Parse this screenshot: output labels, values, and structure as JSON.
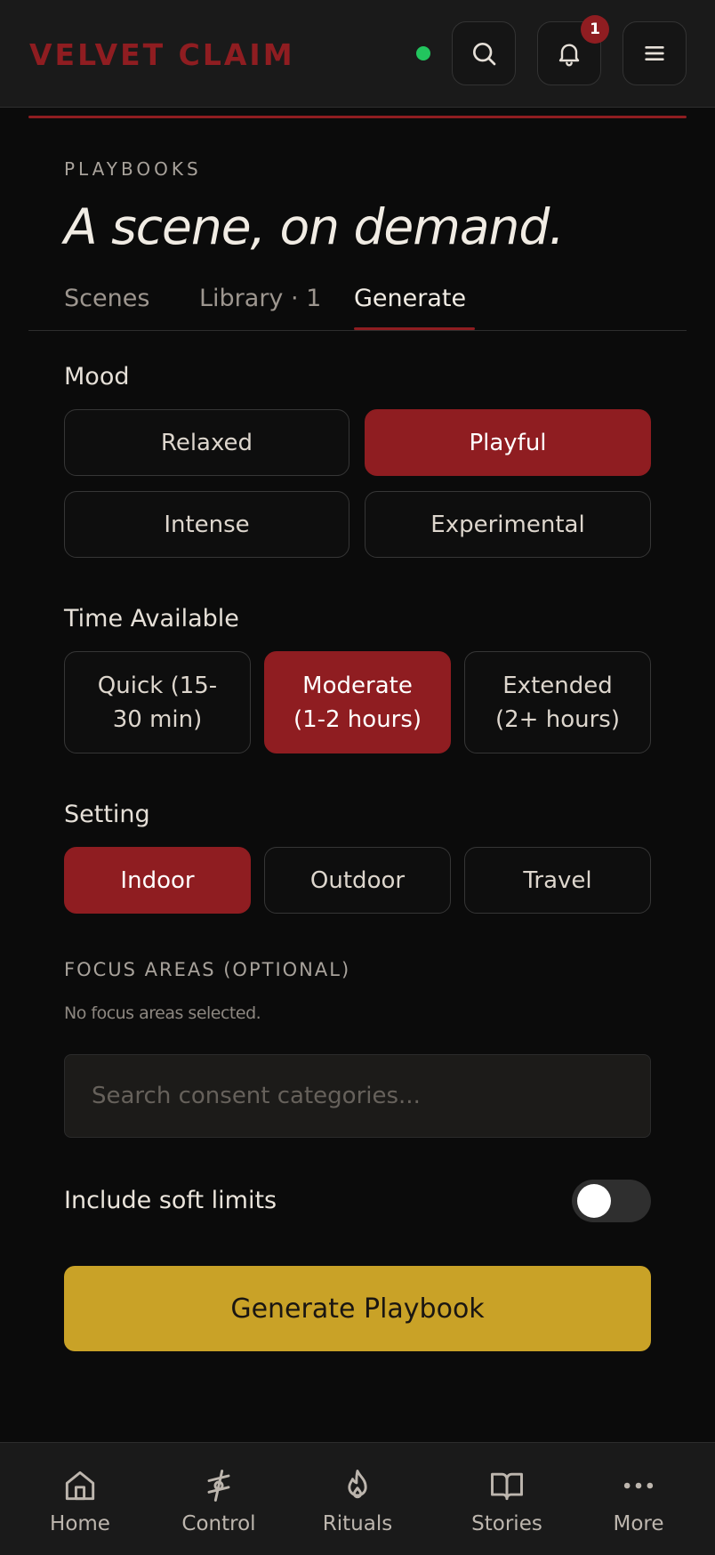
{
  "app": {
    "brand": "VELVET CLAIM",
    "notification_count": "1"
  },
  "header": {
    "eyebrow": "PLAYBOOKS",
    "headline": "A scene, on demand."
  },
  "tabs": [
    {
      "label": "Scenes",
      "active": false
    },
    {
      "label": "Library · 1",
      "active": false
    },
    {
      "label": "Generate",
      "active": true
    }
  ],
  "mood": {
    "label": "Mood",
    "options": [
      "Relaxed",
      "Playful",
      "Intense",
      "Experimental"
    ],
    "selected": "Playful"
  },
  "time": {
    "label": "Time Available",
    "options": [
      "Quick (15-30 min)",
      "Moderate (1-2 hours)",
      "Extended (2+ hours)"
    ],
    "selected": "Moderate (1-2 hours)"
  },
  "setting": {
    "label": "Setting",
    "options": [
      "Indoor",
      "Outdoor",
      "Travel"
    ],
    "selected": "Indoor"
  },
  "focus": {
    "label": "FOCUS AREAS (OPTIONAL)",
    "empty_text": "No focus areas selected.",
    "search_placeholder": "Search consent categories..."
  },
  "soft_limits": {
    "label": "Include soft limits",
    "enabled": false
  },
  "generate_button": "Generate Playbook",
  "bottom_nav": [
    {
      "label": "Home",
      "icon": "home-icon"
    },
    {
      "label": "Control",
      "icon": "control-icon"
    },
    {
      "label": "Rituals",
      "icon": "flame-icon"
    },
    {
      "label": "Stories",
      "icon": "book-icon"
    },
    {
      "label": "More",
      "icon": "more-icon"
    }
  ],
  "colors": {
    "accent_red": "#8f1d21",
    "gold": "#c9a227",
    "online_green": "#22c55e",
    "background": "#0b0b0b"
  }
}
